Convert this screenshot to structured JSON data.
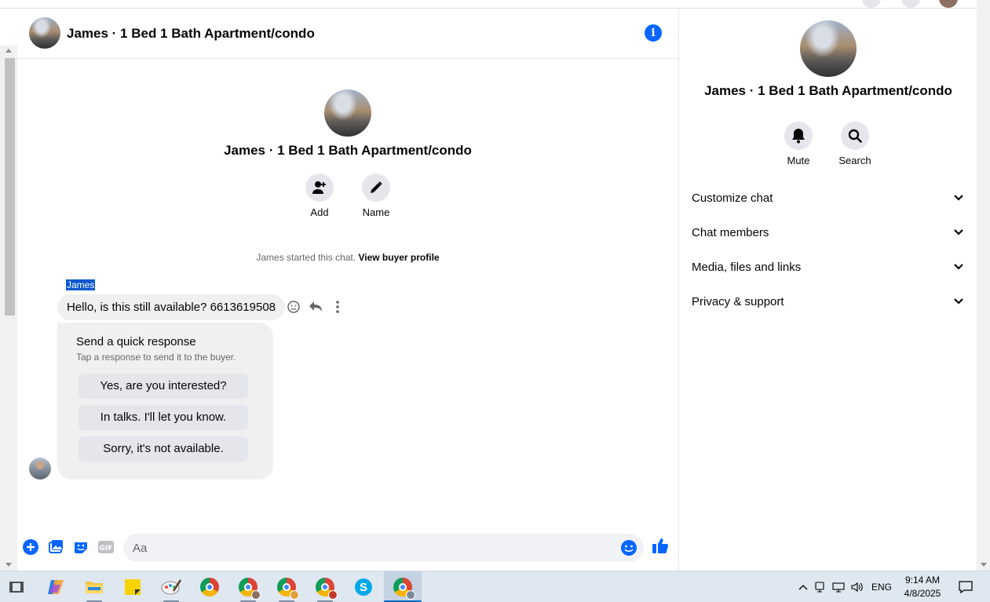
{
  "chat": {
    "header_title": "James · 1 Bed 1 Bath Apartment/condo",
    "center_title": "James · 1 Bed 1 Bath Apartment/condo",
    "actions": [
      {
        "label": "Add",
        "icon": "add-person-icon"
      },
      {
        "label": "Name",
        "icon": "pencil-icon"
      }
    ],
    "system_message": "James started this chat.",
    "system_link": "View buyer profile",
    "sender": "James",
    "message": "Hello, is this still available? 6613619508",
    "quick_response": {
      "title": "Send a quick response",
      "subtitle": "Tap a response to send it to the buyer.",
      "options": [
        "Yes, are you interested?",
        "In talks. I'll let you know.",
        "Sorry, it's not available."
      ]
    },
    "composer": {
      "placeholder": "Aa"
    }
  },
  "right_panel": {
    "title": "James · 1 Bed 1 Bath Apartment/condo",
    "actions": [
      {
        "label": "Mute",
        "icon": "bell-icon"
      },
      {
        "label": "Search",
        "icon": "search-icon"
      }
    ],
    "sections": [
      "Customize chat",
      "Chat members",
      "Media, files and links",
      "Privacy & support"
    ]
  },
  "taskbar": {
    "language": "ENG",
    "time": "9:14 AM",
    "date": "4/8/2025"
  },
  "colors": {
    "accent": "#0866ff",
    "bubble": "#f0f0f0",
    "taskbar": "#dfe7f0"
  }
}
